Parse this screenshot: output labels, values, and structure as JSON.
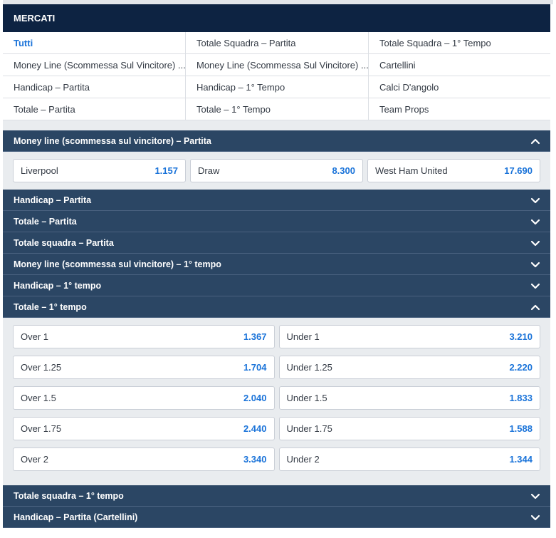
{
  "mercati": {
    "title": "MERCATI",
    "cells": [
      "Tutti",
      "Totale Squadra – Partita",
      "Totale Squadra – 1° Tempo",
      "Money Line (Scommessa Sul Vincitore) ...",
      "Money Line (Scommessa Sul Vincitore) ...",
      "Cartellini",
      "Handicap – Partita",
      "Handicap – 1° Tempo",
      "Calci D'angolo",
      "Totale – Partita",
      "Totale – 1° Tempo",
      "Team Props"
    ]
  },
  "sections": [
    {
      "title": "Money line (scommessa sul vincitore) – Partita",
      "expanded": true,
      "odds": [
        [
          "Liverpool",
          "1.157"
        ],
        [
          "Draw",
          "8.300"
        ],
        [
          "West Ham United",
          "17.690"
        ]
      ]
    },
    {
      "title": "Handicap – Partita",
      "expanded": false
    },
    {
      "title": "Totale – Partita",
      "expanded": false
    },
    {
      "title": "Totale squadra – Partita",
      "expanded": false
    },
    {
      "title": "Money line (scommessa sul vincitore) – 1° tempo",
      "expanded": false
    },
    {
      "title": "Handicap – 1° tempo",
      "expanded": false
    },
    {
      "title": "Totale – 1° tempo",
      "expanded": true,
      "rows": [
        [
          [
            "Over 1",
            "1.367"
          ],
          [
            "Under 1",
            "3.210"
          ]
        ],
        [
          [
            "Over 1.25",
            "1.704"
          ],
          [
            "Under 1.25",
            "2.220"
          ]
        ],
        [
          [
            "Over 1.5",
            "2.040"
          ],
          [
            "Under 1.5",
            "1.833"
          ]
        ],
        [
          [
            "Over 1.75",
            "2.440"
          ],
          [
            "Under 1.75",
            "1.588"
          ]
        ],
        [
          [
            "Over 2",
            "3.340"
          ],
          [
            "Under 2",
            "1.344"
          ]
        ]
      ]
    },
    {
      "title": "Totale squadra – 1° tempo",
      "expanded": false
    },
    {
      "title": "Handicap – Partita (Cartellini)",
      "expanded": false
    }
  ],
  "colors": {
    "header_dark": "#0d2342",
    "section": "#2b4664",
    "accent": "#1a73d9"
  },
  "icons": {
    "expanded": "chevron-up-icon",
    "collapsed": "chevron-down-icon"
  }
}
